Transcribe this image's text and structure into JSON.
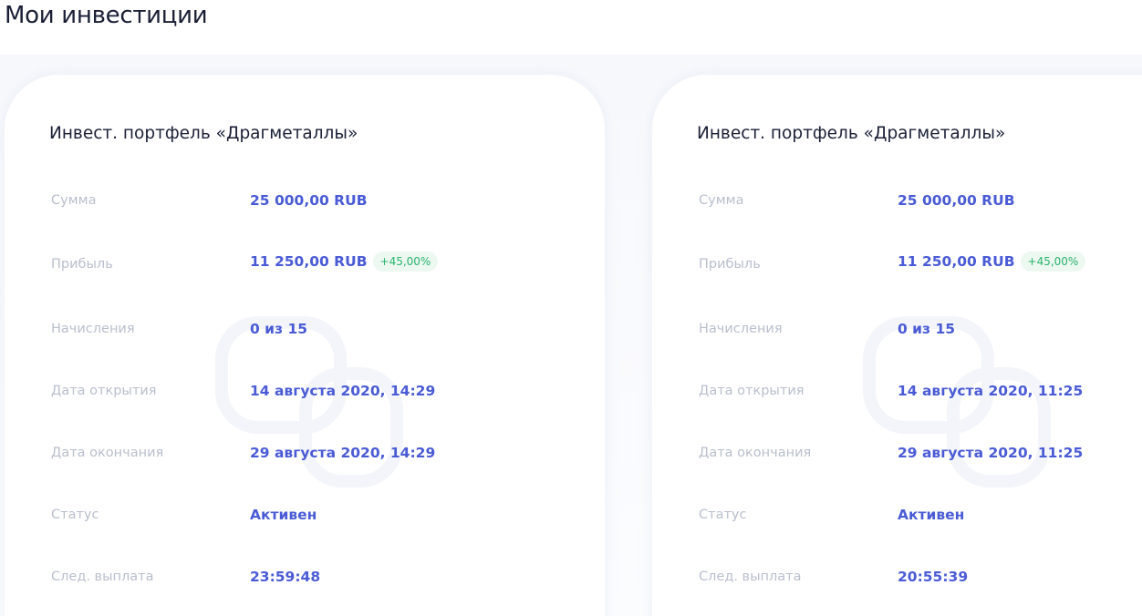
{
  "page": {
    "title": "Мои инвестиции"
  },
  "cards": [
    {
      "title": "Инвест. портфель «Драгметаллы»",
      "rows": [
        {
          "label": "Сумма",
          "value": "25 000,00 RUB"
        },
        {
          "label": "Прибыль",
          "value": "11 250,00 RUB",
          "badge": "+45,00%"
        },
        {
          "label": "Начисления",
          "value": "0 из 15"
        },
        {
          "label": "Дата открытия",
          "value": "14 августа 2020, 14:29"
        },
        {
          "label": "Дата окончания",
          "value": "29 августа 2020, 14:29"
        },
        {
          "label": "Статус",
          "value": "Активен"
        },
        {
          "label": "След. выплата",
          "value": "23:59:48"
        }
      ]
    },
    {
      "title": "Инвест. портфель «Драгметаллы»",
      "rows": [
        {
          "label": "Сумма",
          "value": "25 000,00 RUB"
        },
        {
          "label": "Прибыль",
          "value": "11 250,00 RUB",
          "badge": "+45,00%"
        },
        {
          "label": "Начисления",
          "value": "0 из 15"
        },
        {
          "label": "Дата открытия",
          "value": "14 августа 2020, 11:25"
        },
        {
          "label": "Дата окончания",
          "value": "29 августа 2020, 11:25"
        },
        {
          "label": "Статус",
          "value": "Активен"
        },
        {
          "label": "След. выплата",
          "value": "20:55:39"
        }
      ]
    }
  ],
  "colors": {
    "value": "#4a5bd6",
    "label": "#b9bfcd",
    "badge_text": "#27b46c",
    "badge_bg": "#edf8f1",
    "title": "#1a1f36"
  }
}
